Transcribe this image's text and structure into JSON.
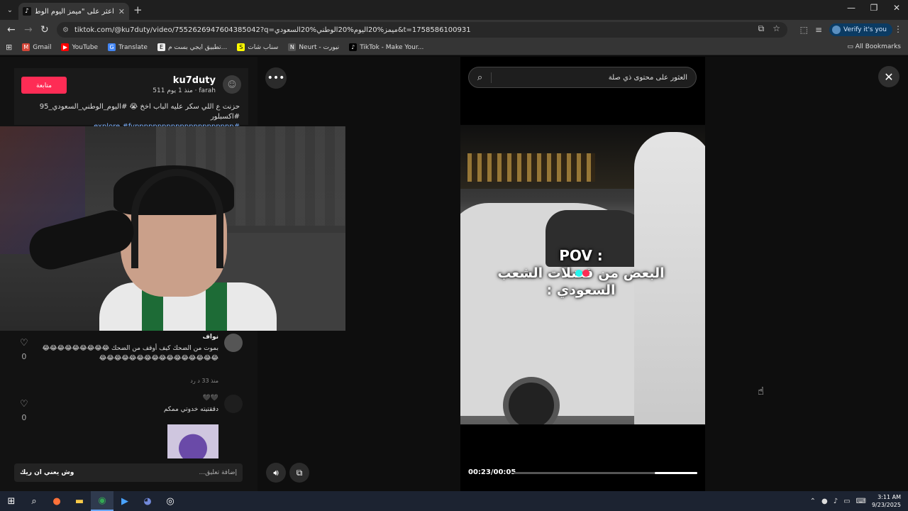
{
  "browser": {
    "tab_title": "اعثر على \"ميمز اليوم الوطني",
    "tab_close": "✕",
    "new_tab": "+",
    "url": "tiktok.com/@ku7duty/video/7552626947604385042?q=ميمز%20اليوم%20الوطني%20السعودي&t=1758586100931",
    "verify_label": "Verify it's you",
    "bookmarks": [
      {
        "label": "Gmail",
        "color": "#d44638",
        "glyph": "M"
      },
      {
        "label": "YouTube",
        "color": "#ff0000",
        "glyph": "▶"
      },
      {
        "label": "Translate",
        "color": "#4285f4",
        "glyph": "G"
      },
      {
        "label": "تطبيق ايجي بست م...",
        "color": "#eeeeee",
        "glyph": "E"
      },
      {
        "label": "سناب شات",
        "color": "#fffc00",
        "glyph": "S"
      },
      {
        "label": "Neurt - نيورت",
        "color": "#555555",
        "glyph": "N"
      },
      {
        "label": "TikTok - Make Your...",
        "color": "#000000",
        "glyph": "♪"
      }
    ],
    "all_bookmarks": "All Bookmarks"
  },
  "post": {
    "username": "ku7duty",
    "meta": "farah · منذ 1 يوم 511",
    "follow_label": "متابعة",
    "caption": "حزنت ع اللي سكر عليه الباب اخخ 😭 #اليوم_الوطني_السعودي_95 #اكسبلور",
    "caption_tags": "#explore #fypppppppppppppppppppppp"
  },
  "comments": [
    {
      "name": "نواف",
      "text": "بموت من الضحك كيف أوقف من الضحك 😂😂😂😂😂😂😂😂😂😂😂😂😂😂😂😂😂😂😂😂😂😂😂😂😂",
      "meta": "منذ 33 د    رد",
      "likes": "0"
    },
    {
      "name": "🖤🖤",
      "text": "دققتيته خدوتي ممكم",
      "meta": "",
      "likes": "0"
    }
  ],
  "comment_bar": {
    "placeholder": "إضافة تعليق...",
    "reply_text": "وش يعني ان ريك"
  },
  "video": {
    "search_placeholder": "العثور على محتوى ذي صلة",
    "overlay_line1": "POV :",
    "overlay_line2": "البعض من فضلات الشعب",
    "overlay_line3": "السعودي :",
    "time": "00:23/00:05",
    "progress": 0.23
  },
  "taskbar": {
    "time": "3:11 AM",
    "date": "9/23/2025"
  }
}
